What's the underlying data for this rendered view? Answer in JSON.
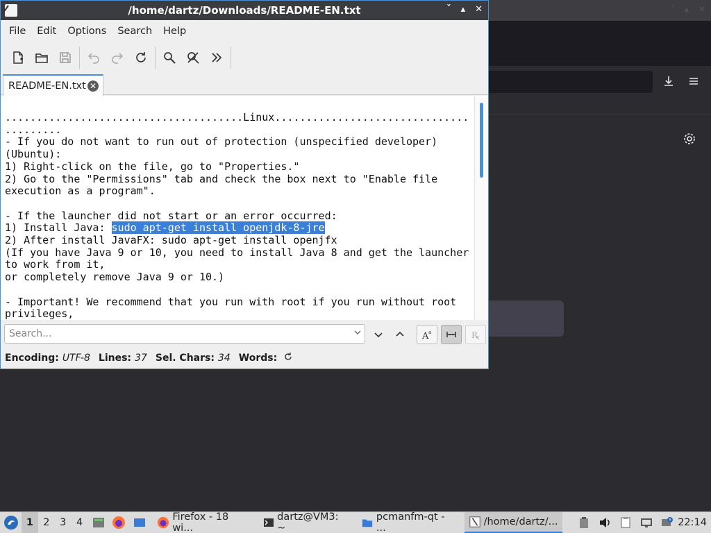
{
  "window": {
    "title": "/home/dartz/Downloads/README-EN.txt",
    "controls": {
      "minimize": "ˇ",
      "restore": "▴",
      "close": "✕"
    }
  },
  "menubar": [
    "File",
    "Edit",
    "Options",
    "Search",
    "Help"
  ],
  "toolbar": {
    "buttons": [
      "new-document",
      "open-folder",
      "save",
      "undo",
      "redo",
      "reload",
      "find",
      "find-replace",
      "more"
    ]
  },
  "tab": {
    "label": "README-EN.txt"
  },
  "editor": {
    "lines_before": [
      "......................................Linux...............................",
      ".........",
      "- If you do not want to run out of protection (unspecified developer)",
      "(Ubuntu):",
      "1) Right-click on the file, go to \"Properties.\"",
      "2) Go to the \"Permissions\" tab and check the box next to \"Enable file",
      "execution as a program\".",
      "",
      "- If the launcher did not start or an error occurred:"
    ],
    "sel_line_prefix": "1) Install Java: ",
    "selected_text": "sudo apt-get install openjdk-8-jre",
    "lines_after": [
      "2) After install JavaFX: sudo apt-get install openjfx",
      "(If you have Java 9 or 10, you need to install Java 8 and get the launcher",
      "to work from it,",
      "or completely remove Java 9 or 10.)",
      "",
      "- Important! We recommend that you run with root if you run without root",
      "privileges,"
    ]
  },
  "search": {
    "placeholder": "Search..."
  },
  "statusbar": {
    "encoding_label": "Encoding:",
    "encoding_value": "UTF-8",
    "lines_label": "Lines:",
    "lines_value": "37",
    "sel_label": "Sel. Chars:",
    "sel_value": "34",
    "words_label": "Words:"
  },
  "taskbar": {
    "workspaces": [
      "1",
      "2",
      "3",
      "4"
    ],
    "tasks": [
      "Firefox - 18 wi...",
      "dartz@VM3: ~",
      "pcmanfm-qt - ...",
      "/home/dartz/..."
    ],
    "clock": "22:14"
  },
  "colors": {
    "accent": "#3b80d8",
    "titlebar": "#3a3c40",
    "selection": "#3b80d8"
  }
}
